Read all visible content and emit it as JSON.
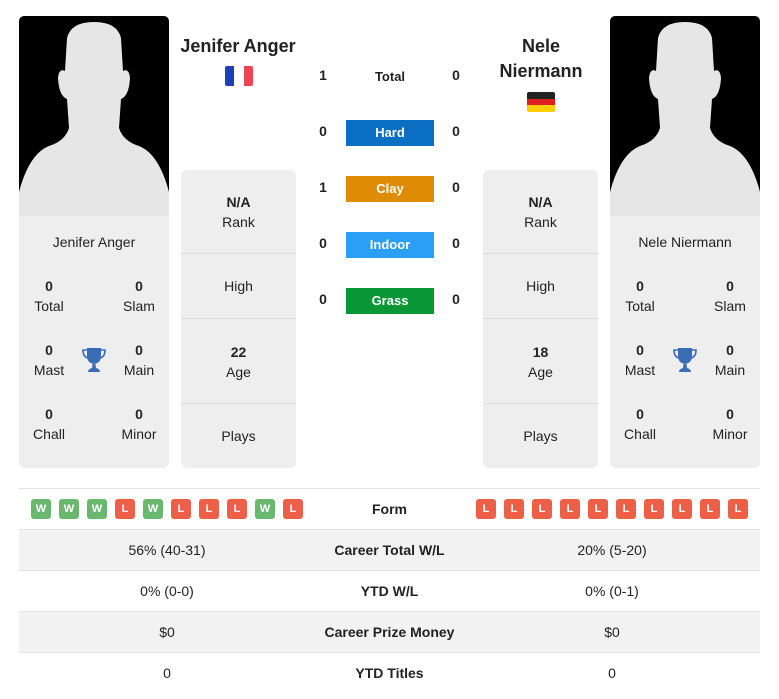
{
  "colors": {
    "hard": "#0a6ec3",
    "clay": "#de8c04",
    "indoor": "#2b9ff5",
    "grass": "#099635",
    "win": "#6ab86d",
    "loss": "#ed5f47",
    "trophy": "#3a6db5"
  },
  "player1": {
    "name": "Jenifer Anger",
    "flag": "france-flag",
    "flag_colors": [
      "#1f3fb8",
      "#ffffff",
      "#ef4454"
    ],
    "card": {
      "name": "Jenifer Anger",
      "total": {
        "value": "0",
        "label": "Total"
      },
      "slam": {
        "value": "0",
        "label": "Slam"
      },
      "mast": {
        "value": "0",
        "label": "Mast"
      },
      "main": {
        "value": "0",
        "label": "Main"
      },
      "chall": {
        "value": "0",
        "label": "Chall"
      },
      "minor": {
        "value": "0",
        "label": "Minor"
      }
    },
    "rank": {
      "value": "N/A",
      "label": "Rank"
    },
    "high": {
      "label": "High"
    },
    "age": {
      "value": "22",
      "label": "Age"
    },
    "plays": {
      "label": "Plays"
    }
  },
  "player2": {
    "name": "Nele Niermann",
    "name_line1": "Nele",
    "name_line2": "Niermann",
    "flag": "germany-flag",
    "flag_colors": [
      "#222222",
      "#dd1f1f",
      "#ffce00"
    ],
    "card": {
      "name": "Nele Niermann",
      "total": {
        "value": "0",
        "label": "Total"
      },
      "slam": {
        "value": "0",
        "label": "Slam"
      },
      "mast": {
        "value": "0",
        "label": "Mast"
      },
      "main": {
        "value": "0",
        "label": "Main"
      },
      "chall": {
        "value": "0",
        "label": "Chall"
      },
      "minor": {
        "value": "0",
        "label": "Minor"
      }
    },
    "rank": {
      "value": "N/A",
      "label": "Rank"
    },
    "high": {
      "label": "High"
    },
    "age": {
      "value": "18",
      "label": "Age"
    },
    "plays": {
      "label": "Plays"
    }
  },
  "h2h": {
    "total": {
      "label": "Total",
      "p1": "1",
      "p2": "0"
    },
    "surfaces": [
      {
        "key": "hard",
        "label": "Hard",
        "p1": "0",
        "p2": "0"
      },
      {
        "key": "clay",
        "label": "Clay",
        "p1": "1",
        "p2": "0"
      },
      {
        "key": "indoor",
        "label": "Indoor",
        "p1": "0",
        "p2": "0"
      },
      {
        "key": "grass",
        "label": "Grass",
        "p1": "0",
        "p2": "0"
      }
    ]
  },
  "comparison": {
    "form": {
      "label": "Form",
      "p1": [
        "W",
        "W",
        "W",
        "L",
        "W",
        "L",
        "L",
        "L",
        "W",
        "L"
      ],
      "p2": [
        "L",
        "L",
        "L",
        "L",
        "L",
        "L",
        "L",
        "L",
        "L",
        "L"
      ]
    },
    "rows": [
      {
        "label": "Career Total W/L",
        "p1": "56% (40-31)",
        "p2": "20% (5-20)"
      },
      {
        "label": "YTD W/L",
        "p1": "0% (0-0)",
        "p2": "0% (0-1)"
      },
      {
        "label": "Career Prize Money",
        "p1": "$0",
        "p2": "$0"
      },
      {
        "label": "YTD Titles",
        "p1": "0",
        "p2": "0"
      }
    ]
  }
}
